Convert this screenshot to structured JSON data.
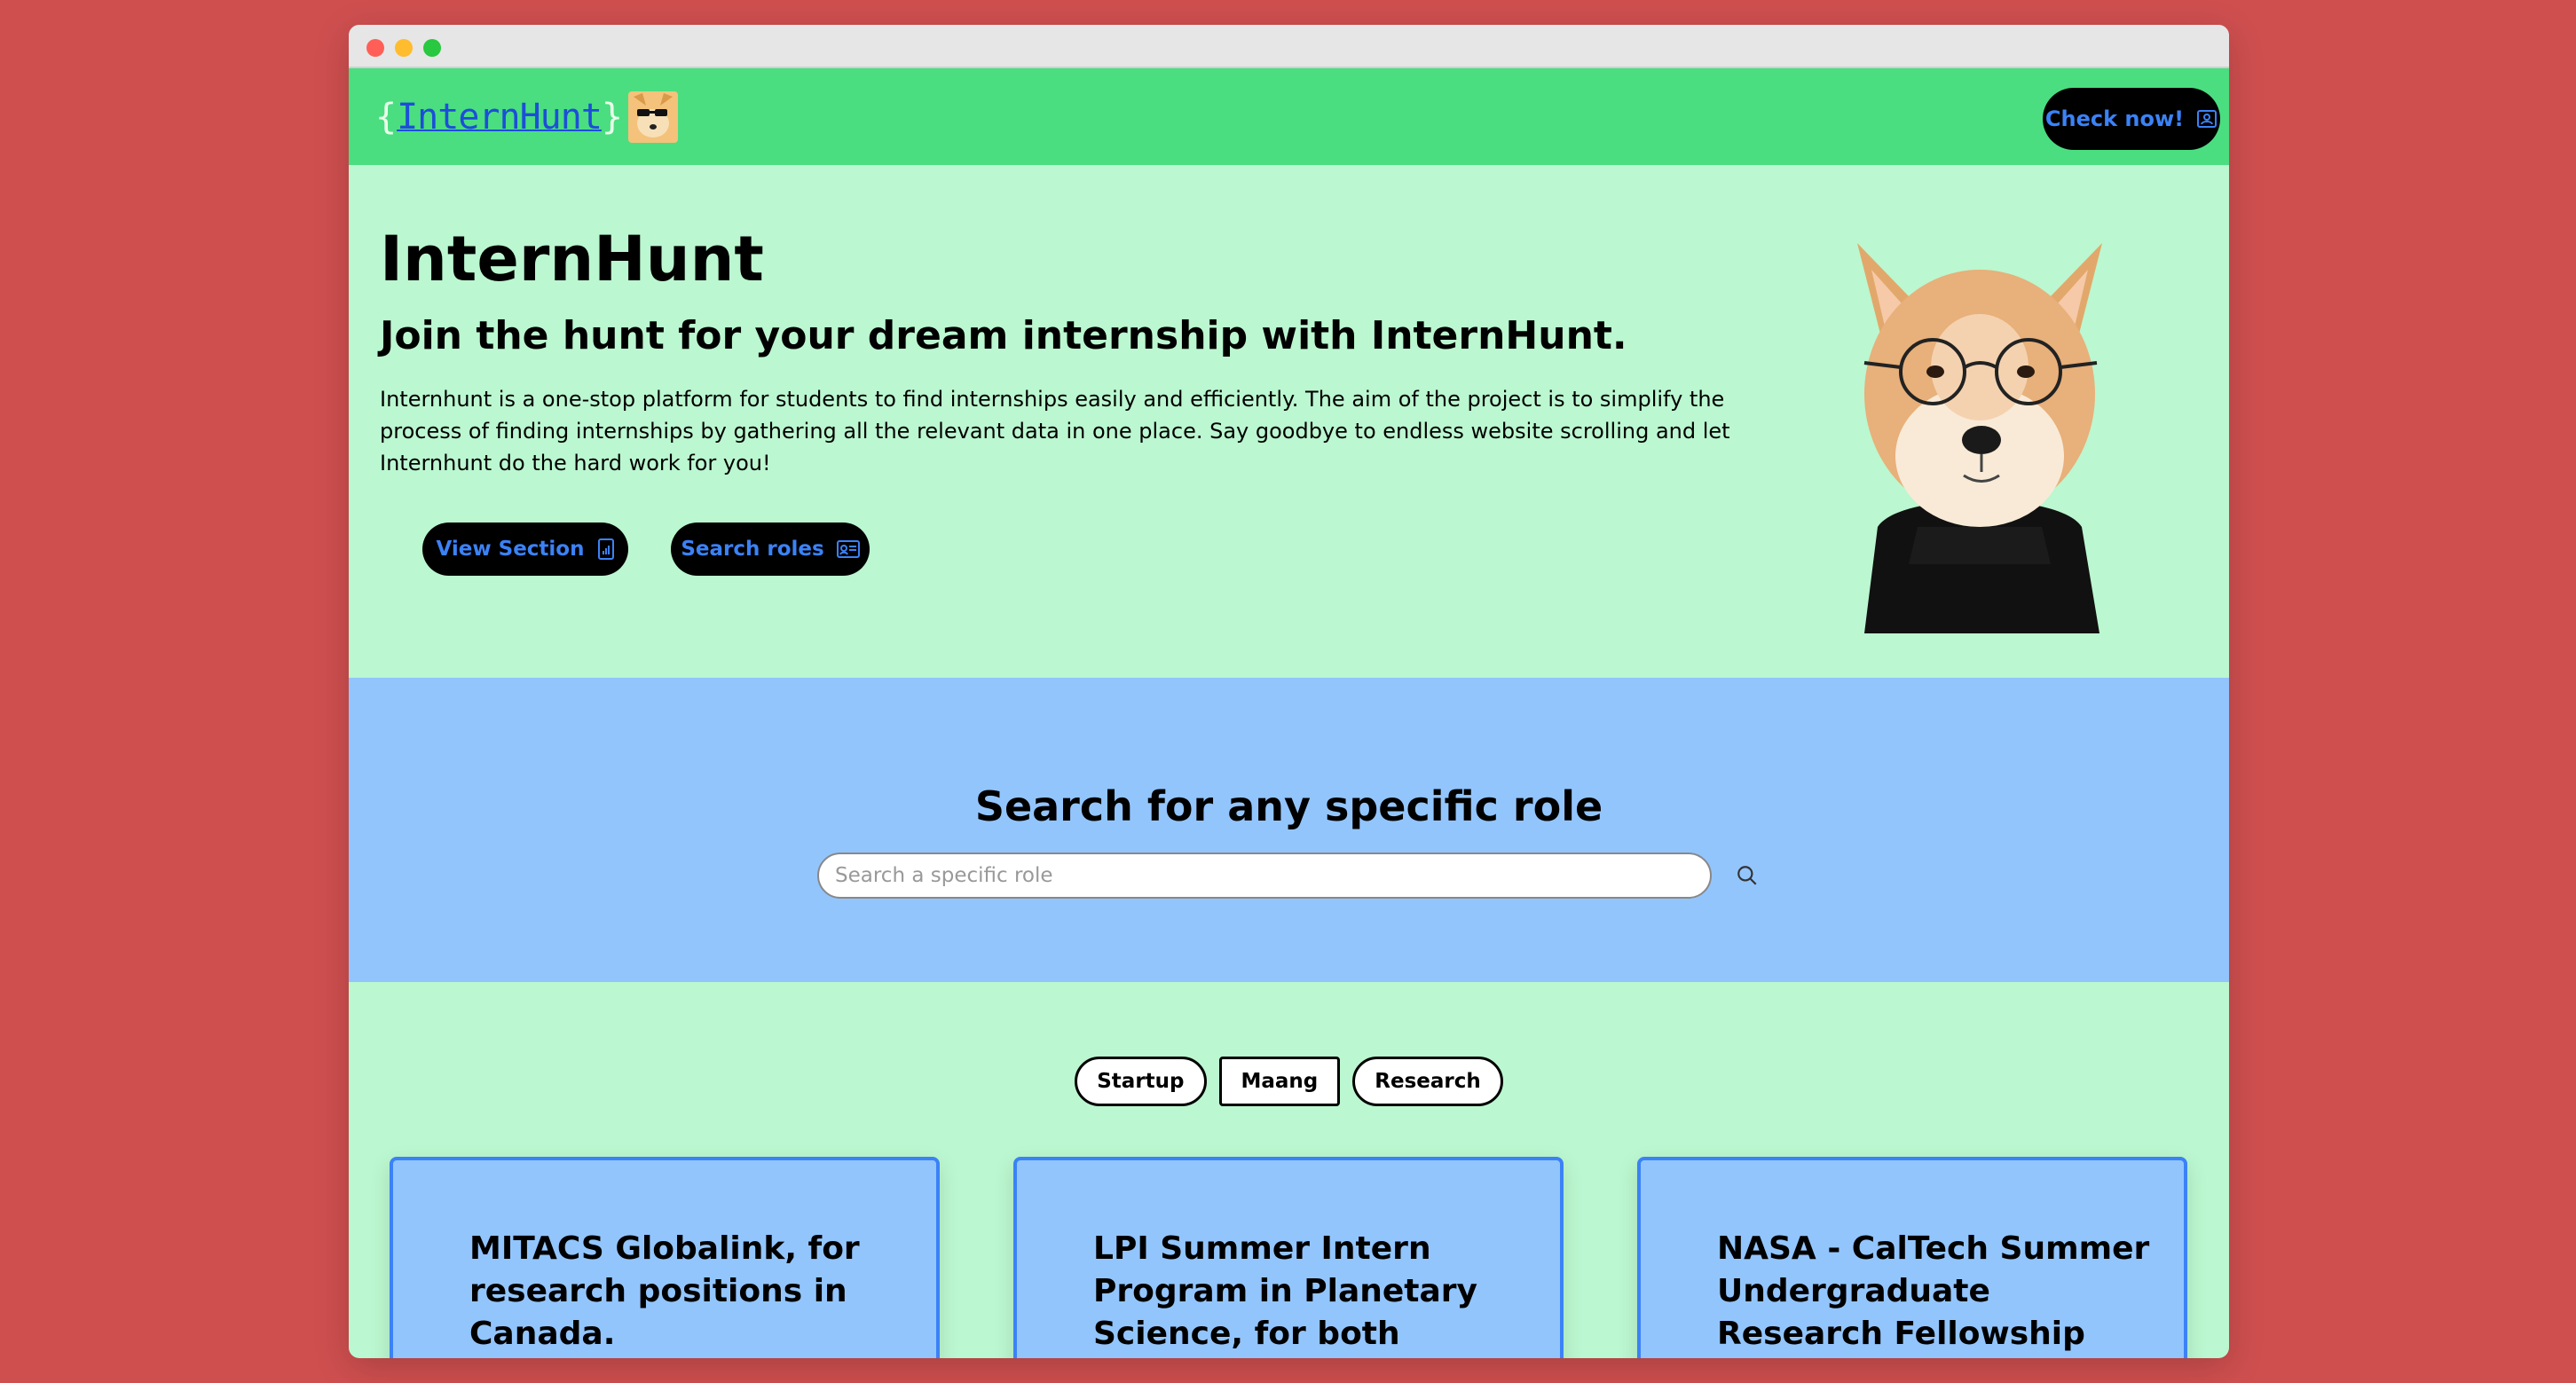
{
  "navbar": {
    "logo_text": "InternHunt",
    "logo_brace_open": "{",
    "logo_brace_close": "}",
    "check_button_label": "Check now!"
  },
  "hero": {
    "title": "InternHunt",
    "subtitle": "Join the hunt for your dream internship with InternHunt.",
    "description": "Internhunt is a one-stop platform for students to find internships easily and efficiently. The aim of the project is to simplify the process of finding internships by gathering all the relevant data in one place. Say goodbye to endless website scrolling and let Internhunt do the hard work for you!",
    "view_button_label": "View Section",
    "search_button_label": "Search roles"
  },
  "search": {
    "title": "Search for any specific role",
    "placeholder": "Search a specific role"
  },
  "filters": [
    "Startup",
    "Maang",
    "Research"
  ],
  "cards": [
    {
      "title": "MITACS Globalink, for research positions in Canada."
    },
    {
      "title": "LPI Summer Intern Program in Planetary Science, for both national and"
    },
    {
      "title": "NASA - CalTech Summer Undergraduate Research Fellowship (SURF), for"
    }
  ],
  "colors": {
    "page_background": "#cf4f4f",
    "navbar": "#4ade80",
    "hero_background": "#bbf7d0",
    "search_background": "#93c5fd",
    "button_text": "#3b82f6",
    "card_border": "#3b82f6"
  },
  "icons": {
    "check_button": "user-badge-icon",
    "view_button": "mobile-chart-icon",
    "search_button": "id-card-icon",
    "search": "search-icon"
  }
}
